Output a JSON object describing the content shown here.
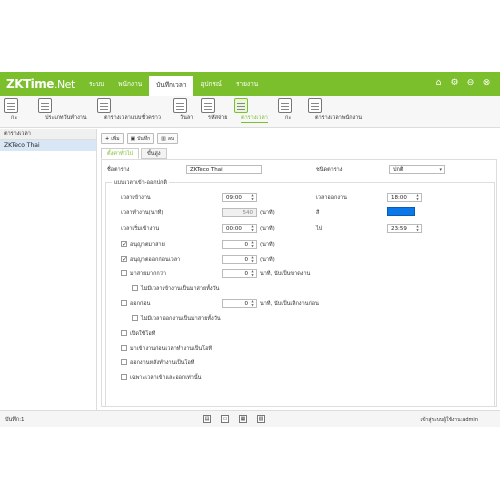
{
  "app": {
    "logo_main": "ZKTime",
    "logo_suffix": ".Net"
  },
  "menu": [
    "ระบบ",
    "พนักงาน",
    "บันทึกเวลา",
    "อุปกรณ์",
    "รายงาน"
  ],
  "top_icons": [
    "home-icon",
    "gear-icon",
    "minimize-icon",
    "close-icon"
  ],
  "toolbar": [
    {
      "label": "กะ",
      "icon": "shift-icon"
    },
    {
      "label": "ประเภทวันทำงาน",
      "icon": "calendar-search-icon"
    },
    {
      "label": "ตารางเวลาแบบชั่วคราว",
      "icon": "temp-schedule-icon"
    },
    {
      "label": "วันลา",
      "icon": "leave-icon"
    },
    {
      "label": "รหัสจ่าย",
      "icon": "pay-code-icon"
    },
    {
      "label": "ตารางเวลา",
      "icon": "timetable-icon"
    },
    {
      "label": "กะ",
      "icon": "shift-list-icon"
    },
    {
      "label": "ตารางเวลาพนักงาน",
      "icon": "employee-schedule-icon"
    }
  ],
  "left_panel": {
    "header": "ตารางเวลา",
    "items": [
      "ZKTeco Thai"
    ]
  },
  "actions": {
    "add": "เพิ่ม",
    "save": "บันทึก",
    "delete": "ลบ"
  },
  "tabs": [
    "ตั้งค่าทั่วไป",
    "ขั้นสูง"
  ],
  "form": {
    "name_label": "ชื่อตาราง",
    "name_value": "ZKTeco Thai",
    "type_label": "ชนิดตาราง",
    "type_value": "ปกติ",
    "group_title": "แบบเวลาเข้า-ออกปกติ",
    "checkin_label": "เวลาเข้างาน",
    "checkin_value": "09:00",
    "checkout_label": "เวลาออกงาน",
    "checkout_value": "18:00",
    "workminutes_label": "เวลาทำงาน(นาที)",
    "workminutes_value": "540",
    "workminutes_unit": "(นาที)",
    "color_label": "สี",
    "color_value": "#0a78e8",
    "startin_label": "เวลาเริ่มเข้างาน",
    "startin_value": "00:00",
    "startin_unit": "(นาที)",
    "endout_label": "ไป",
    "endout_value": "23:59",
    "late_label": "อนุญาตมาสาย",
    "late_value": "0",
    "late_unit": "(นาที)",
    "early_label": "อนุญาตออกก่อนเวลา",
    "early_value": "0",
    "early_unit": "(นาที)",
    "latemore_label": "มาสายมากกว่า",
    "latemore_value": "0",
    "latemore_unit": "นาที, นับเป็นขาดงาน",
    "late_notrecord_label": "ไม่มีเวลาเข้างานเป็นมาสายทั้งวัน",
    "leave_early_label": "ออกก่อน",
    "leave_early_value": "0",
    "leave_early_unit": "นาที, นับเป็นเลิกงานก่อน",
    "early_notrecord_label": "ไม่มีเวลาออกงานเป็นมาสายทั้งวัน",
    "ot_label": "เปิดใช้โอที",
    "before_ot_label": "มาเข้างานก่อนเวลาทำงานเป็นโอที",
    "after_ot_label": "ออกงานหลังทำงานเป็นโอที",
    "only_in_out_label": "เฉพาะเวลาเข้าและออกเท่านั้น",
    "checks": {
      "late": true,
      "early": true,
      "latemore": false,
      "late_notrecord": false,
      "leave_early": false,
      "early_notrecord": false,
      "ot": false,
      "before_ot": false,
      "after_ot": false,
      "only_in_out": false
    }
  },
  "status": {
    "left": "บันทึก:1",
    "right": "เข้าสู่ระบบผู้ใช้งาน:admin"
  }
}
